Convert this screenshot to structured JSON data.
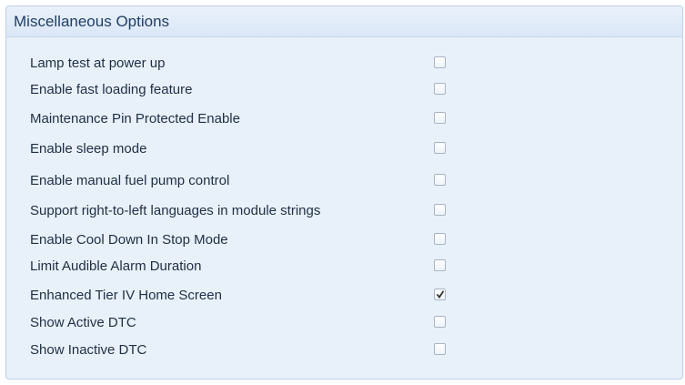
{
  "panel": {
    "title": "Miscellaneous Options",
    "options": [
      {
        "label": "Lamp test at power up",
        "checked": false
      },
      {
        "label": "Enable fast loading feature",
        "checked": false
      },
      {
        "label": "Maintenance Pin Protected Enable",
        "checked": false
      },
      {
        "label": "Enable sleep mode",
        "checked": false
      },
      {
        "label": "Enable manual fuel pump control",
        "checked": false
      },
      {
        "label": "Support right-to-left languages in module strings",
        "checked": false
      },
      {
        "label": "Enable Cool Down In Stop Mode",
        "checked": false
      },
      {
        "label": "Limit Audible Alarm Duration",
        "checked": false
      },
      {
        "label": "Enhanced Tier IV Home Screen",
        "checked": true
      },
      {
        "label": "Show Active DTC",
        "checked": false
      },
      {
        "label": "Show Inactive DTC",
        "checked": false
      }
    ]
  },
  "colors": {
    "panel_background": "#e8f0fa",
    "header_text": "#1f3f66",
    "label_text": "#1f2f44",
    "checkbox_border": "#a8b5c5",
    "checkmark": "#333333"
  }
}
